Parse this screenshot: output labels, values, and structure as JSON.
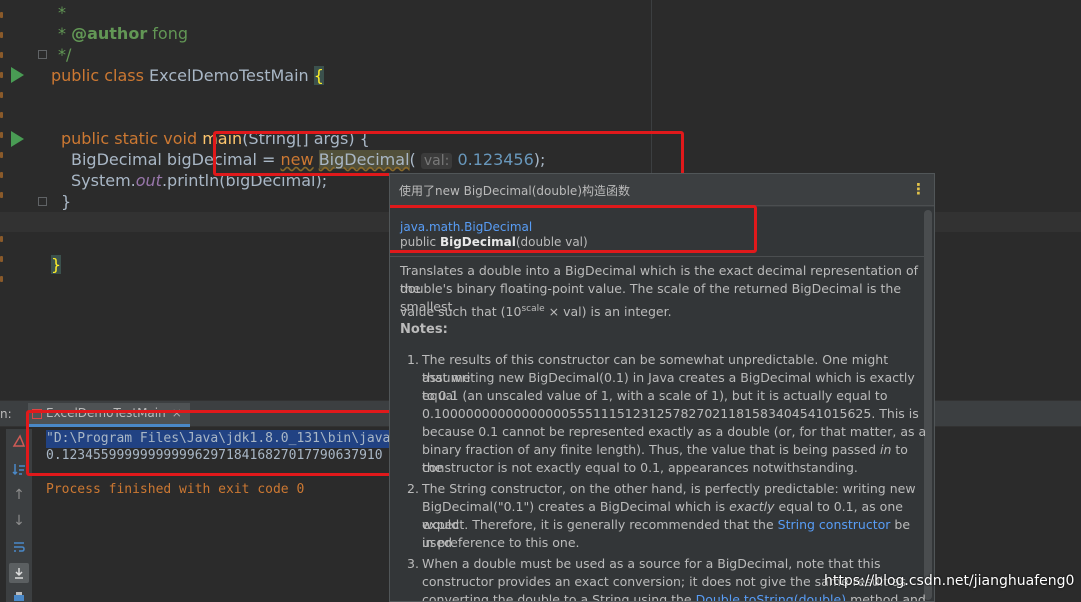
{
  "editor": {
    "doc_star": "*",
    "doc_author_tag": "@author",
    "doc_author_name": "fong",
    "doc_end": "*/",
    "class_kw": "public class",
    "class_name": "ExcelDemoTestMain",
    "class_brace": "{",
    "main_sig_kw": "public static void",
    "main_name": "main",
    "main_params": "(String[] args) {",
    "decl_type": "BigDecimal",
    "decl_var": "bigDecimal",
    "decl_eq": "=",
    "decl_new": "new",
    "decl_ctor": "BigDecimal",
    "decl_open": "(",
    "param_hint": "val:",
    "decl_value": "0.123456",
    "decl_close": ");",
    "print_obj": "System.",
    "print_field": "out",
    "print_call": ".println(bigDecimal);",
    "close_brace_1": "}",
    "close_brace_2": "}"
  },
  "run_panel": {
    "prefix": "n:",
    "tab_label": "ExcelDemoTestMain",
    "tab_close": "×",
    "console": {
      "cmd_line": "\"D:\\Program Files\\Java\\jdk1.8.0_131\\bin\\java",
      "output_line": "0.12345599999999999629718416827017790637910",
      "exit_line": "Process finished with exit code 0"
    },
    "toolbar_icons": [
      "rerun-icon",
      "sort-icon",
      "up-icon",
      "down-icon",
      "wrap-icon",
      "scroll-end-icon",
      "print-icon"
    ]
  },
  "doc_popup": {
    "header": "使用了new BigDecimal(double)构造函数",
    "menu_glyph": "⋮",
    "signature_pkg": "java.math.BigDecimal",
    "signature_prefix": "public",
    "signature_name": "BigDecimal",
    "signature_params": "(double val)",
    "para_1_line_1": "Translates a double into a BigDecimal which is the exact decimal representation of the",
    "para_1_line_2": "double's binary floating-point value. The scale of the returned BigDecimal is the smallest",
    "para_1_line_3a": "value such that (10",
    "para_1_sup": "scale",
    "para_1_line_3b": " × val) is an integer.",
    "notes_heading": "Notes:",
    "note_1_num": "1.",
    "note_1_l1": "The results of this constructor can be somewhat unpredictable. One might assume",
    "note_1_l2": "that writing new BigDecimal(0.1) in Java creates a BigDecimal which is exactly equal",
    "note_1_l3": "to 0.1 (an unscaled value of 1, with a scale of 1), but it is actually equal to",
    "note_1_l4": "0.1000000000000000055511151231257827021181583404541015625. This is",
    "note_1_l5": "because 0.1 cannot be represented exactly as a double (or, for that matter, as a",
    "note_1_l6a": "binary fraction of any finite length). Thus, the value that is being passed ",
    "note_1_l6_em": "in",
    "note_1_l6b": " to the",
    "note_1_l7": "constructor is not exactly equal to 0.1, appearances notwithstanding.",
    "note_2_num": "2.",
    "note_2_l1": "The String constructor, on the other hand, is perfectly predictable: writing new",
    "note_2_l2a": "BigDecimal(\"0.1\") creates a BigDecimal which is ",
    "note_2_l2_em": "exactly",
    "note_2_l2b": " equal to 0.1, as one would",
    "note_2_l3a": "expect. Therefore, it is generally recommended that the ",
    "note_2_l3_link": "String constructor",
    "note_2_l3b": " be used",
    "note_2_l4": "in preference to this one.",
    "note_3_num": "3.",
    "note_3_l1": "When a double must be used as a source for a BigDecimal, note that this",
    "note_3_l2": "constructor provides an exact conversion; it does not give the same result as",
    "note_3_l3a": "converting the double to a String using the ",
    "note_3_l3_link": "Double.toString(double)",
    "note_3_l3b": " method and then"
  },
  "watermark": "https://blog.csdn.net/jianghuafeng0",
  "colors": {
    "editor_bg": "#2b2b2b",
    "keyword": "#cc7832",
    "doc_comment": "#629755",
    "number": "#6897bb",
    "annotation_box": "#e0191b",
    "link": "#589df6"
  }
}
